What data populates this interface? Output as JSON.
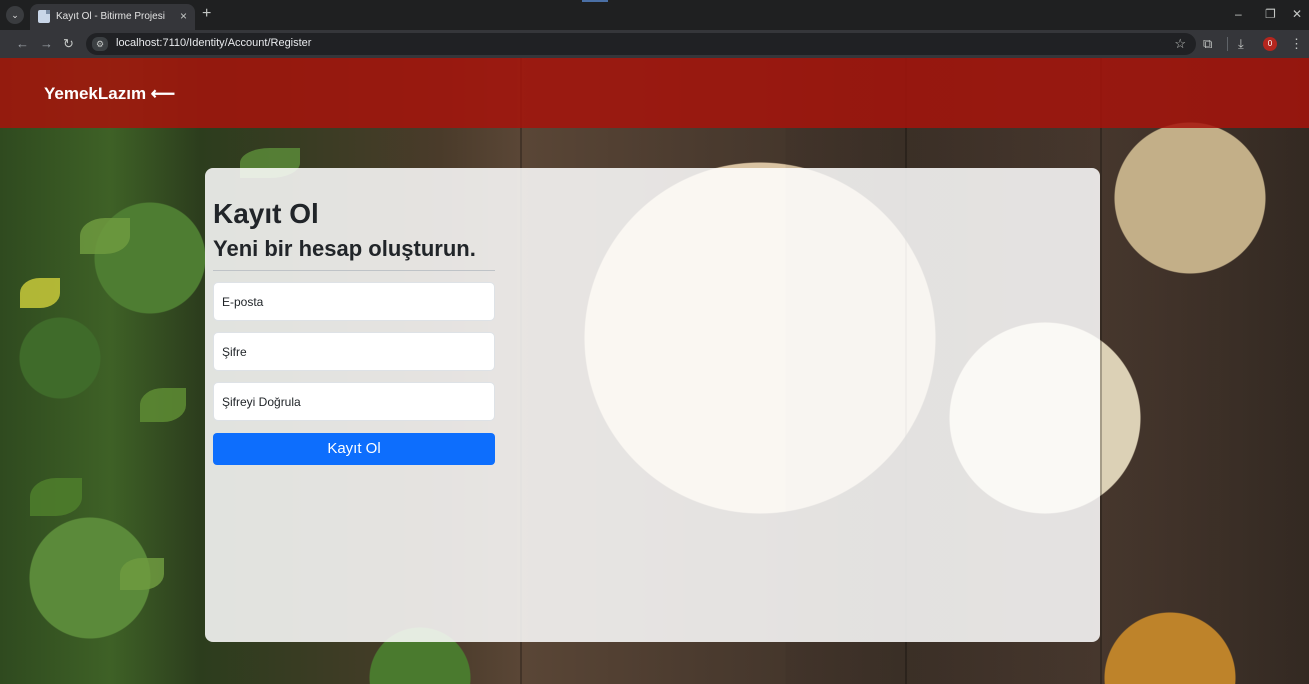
{
  "browser": {
    "tab_title": "Kayıt Ol - Bitirme Projesi",
    "tab_close": "×",
    "new_tab": "+",
    "url": "localhost:7110/Identity/Account/Register",
    "extension_badge": "0",
    "icons": {
      "tab_menu": "chevron-down-icon",
      "back": "back-arrow-icon",
      "forward": "forward-arrow-icon",
      "reload": "reload-icon",
      "site_info": "site-info-icon",
      "bookmark": "star-icon",
      "extensions": "puzzle-icon",
      "downloads": "download-icon",
      "minimize": "minimize-icon",
      "restore": "restore-icon",
      "close": "close-icon"
    },
    "colors": {
      "chrome_dark": "#1f2021",
      "chrome_toolbar": "#35363a",
      "badge": "#b3261e"
    }
  },
  "navbar": {
    "brand": "YemekLazım ⟵",
    "color": "#a5140c"
  },
  "register": {
    "title": "Kayıt Ol",
    "subtitle": "Yeni bir hesap oluşturun.",
    "fields": [
      {
        "label": "E-posta"
      },
      {
        "label": "Şifre"
      },
      {
        "label": "Şifreyi Doğrula"
      }
    ],
    "submit_label": "Kayıt Ol",
    "button_color": "#0d6efd"
  }
}
